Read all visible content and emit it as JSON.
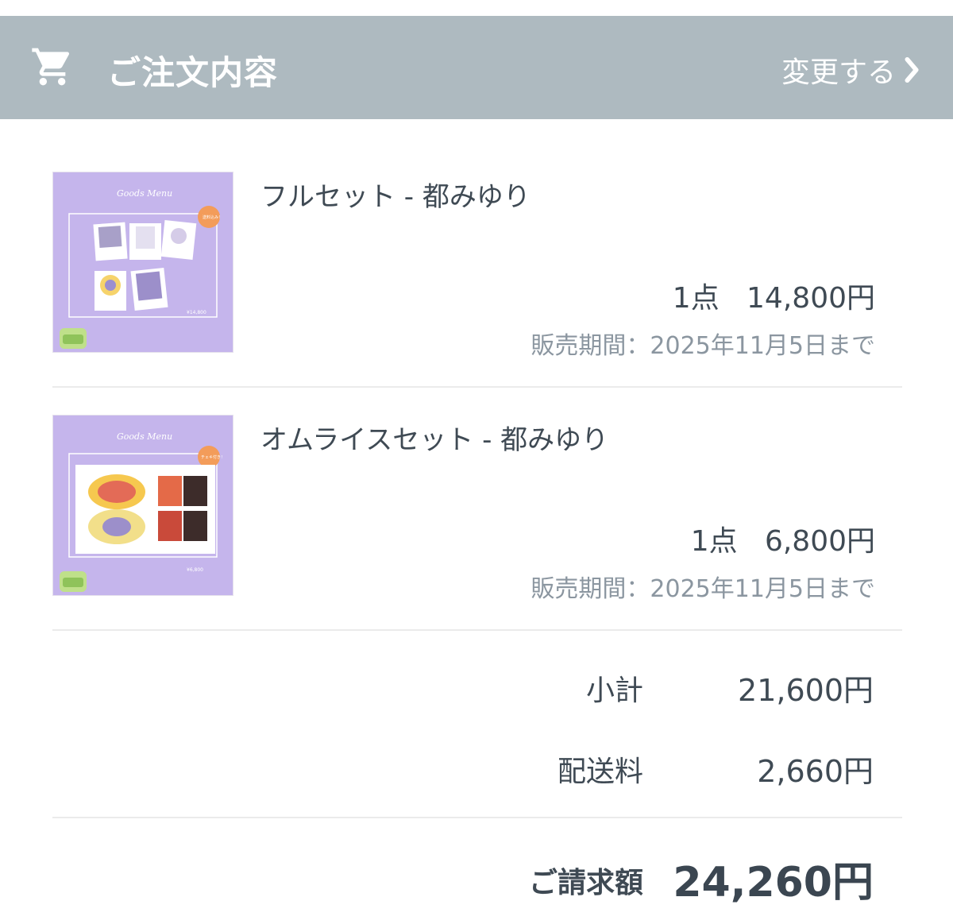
{
  "header": {
    "title": "ご注文内容",
    "change_label": "変更する",
    "cart_icon": "shopping-cart-icon",
    "chevron_icon": "chevron-right-icon"
  },
  "items": [
    {
      "name": "フルセット - 都みゆり",
      "qty_price": "1点   14,800円",
      "period": "販売期間：2025年11月5日まで",
      "thumb": {
        "menu_title": "Goods Menu",
        "badge": "送料込み！",
        "price": "¥14,800"
      }
    },
    {
      "name": "オムライスセット - 都みゆり",
      "qty_price": "1点   6,800円",
      "period": "販売期間：2025年11月5日まで",
      "thumb": {
        "menu_title": "Goods Menu",
        "badge": "チェキ付き！",
        "price": "¥6,800"
      }
    }
  ],
  "summary": {
    "subtotal_label": "小計",
    "subtotal_value": "21,600円",
    "shipping_label": "配送料",
    "shipping_value": "2,660円",
    "total_label": "ご請求額",
    "total_value": "24,260円"
  },
  "colors": {
    "header_bg": "#aebac0",
    "thumb_bg": "#c4b3ea",
    "badge": "#f39c5a"
  }
}
